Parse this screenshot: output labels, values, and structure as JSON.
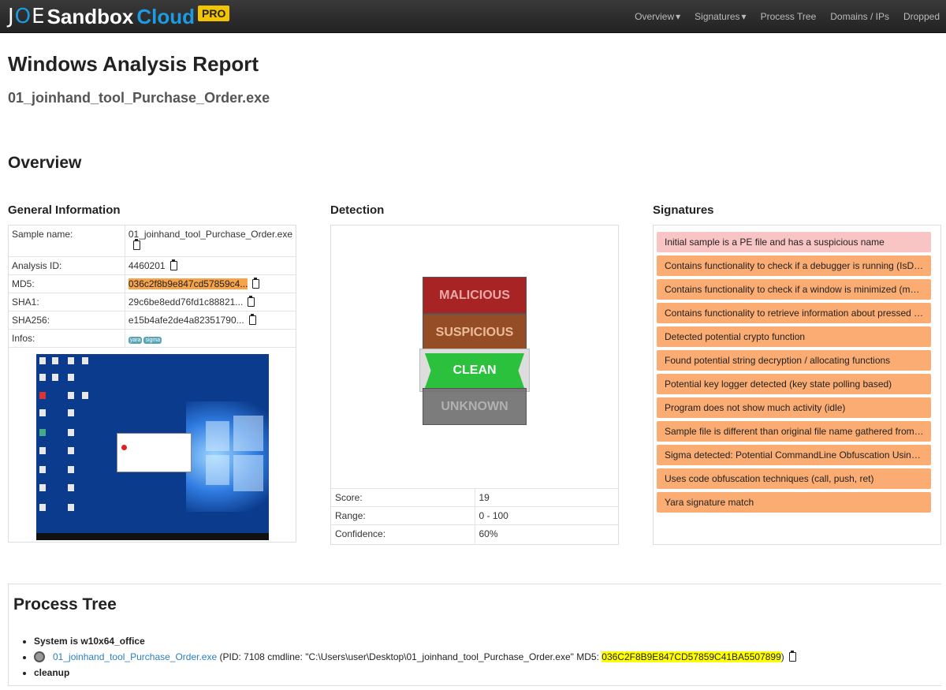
{
  "nav": {
    "logo_joe": "JOE",
    "logo_sandbox": "Sandbox",
    "logo_cloud": "Cloud",
    "logo_pro": "PRO",
    "links": [
      "Overview",
      "Signatures",
      "Process Tree",
      "Domains / IPs",
      "Dropped"
    ]
  },
  "report": {
    "title": "Windows Analysis Report",
    "file": "01_joinhand_tool_Purchase_Order.exe",
    "overview": "Overview"
  },
  "general": {
    "heading": "General Information",
    "rows": [
      {
        "key": "Sample name:",
        "value": "01_joinhand_tool_Purchase_Order.exe"
      },
      {
        "key": "Analysis ID:",
        "value": "4460201"
      },
      {
        "key": "MD5:",
        "value": "036c2f8b9e847cd57859c4..."
      },
      {
        "key": "SHA1:",
        "value": "29c6be8edd76fd1c88821..."
      },
      {
        "key": "SHA256:",
        "value": "e15b4afe2de4a82351790..."
      },
      {
        "key": "Infos:",
        "value": ""
      }
    ],
    "tags": [
      "yara",
      "sigma"
    ]
  },
  "detection": {
    "heading": "Detection",
    "levels": [
      "MALICIOUS",
      "SUSPICIOUS",
      "CLEAN",
      "UNKNOWN"
    ],
    "rows": [
      {
        "key": "Score:",
        "value": "19"
      },
      {
        "key": "Range:",
        "value": "0 - 100"
      },
      {
        "key": "Confidence:",
        "value": "60%"
      }
    ]
  },
  "signatures": {
    "heading": "Signatures",
    "items": [
      "Initial sample is a PE file and has a suspicious name",
      "Contains functionality to check if a debugger is running (IsDeb...",
      "Contains functionality to check if a window is minimized (may b...",
      "Contains functionality to retrieve information about pressed key...",
      "Detected potential crypto function",
      "Found potential string decryption / allocating functions",
      "Potential key logger detected (key state polling based)",
      "Program does not show much activity (idle)",
      "Sample file is different than original file name gathered from ve...",
      "Sigma detected: Potential CommandLine Obfuscation Using U...",
      "Uses code obfuscation techniques (call, push, ret)",
      "Yara signature match"
    ]
  },
  "process_tree": {
    "heading": "Process Tree",
    "system": "System is w10x64_office",
    "proc_name": "01_joinhand_tool_Purchase_Order.exe",
    "proc_info": " (PID: 7108 cmdline: \"C:\\Users\\user\\Desktop\\01_joinhand_tool_Purchase_Order.exe\" MD5: ",
    "proc_md5": "036C2F8B9E847CD57859C41BA5507899",
    "proc_close": ")",
    "cleanup": "cleanup"
  }
}
